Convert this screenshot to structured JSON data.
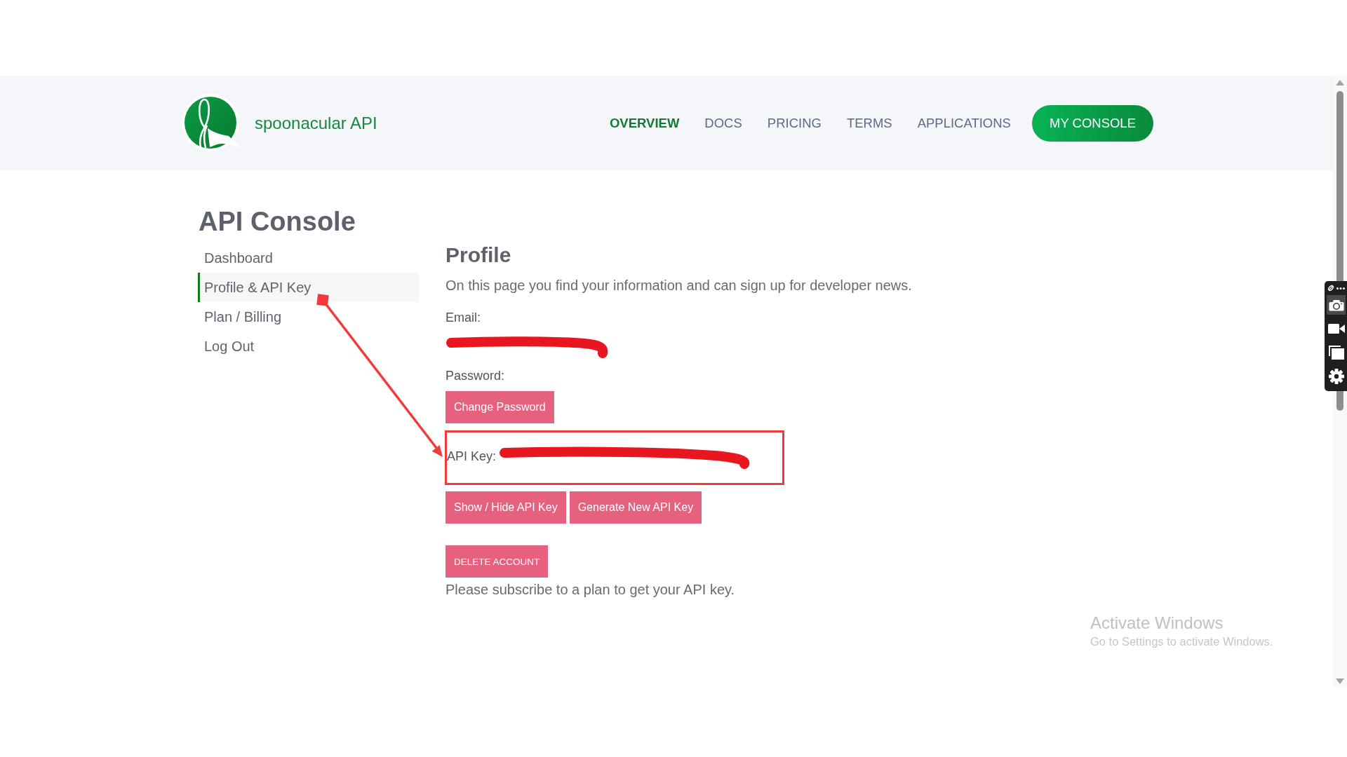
{
  "header": {
    "brand": "spoonacular API",
    "nav": [
      {
        "label": "OVERVIEW",
        "selected": true
      },
      {
        "label": "DOCS",
        "selected": false
      },
      {
        "label": "PRICING",
        "selected": false
      },
      {
        "label": "TERMS",
        "selected": false
      },
      {
        "label": "APPLICATIONS",
        "selected": false
      }
    ],
    "console_button": "MY CONSOLE"
  },
  "sidebar": {
    "title": "API Console",
    "items": [
      {
        "label": "Dashboard",
        "selected": false
      },
      {
        "label": "Profile & API Key",
        "selected": true
      },
      {
        "label": "Plan / Billing",
        "selected": false
      },
      {
        "label": "Log Out",
        "selected": false
      }
    ]
  },
  "profile": {
    "title": "Profile",
    "description": "On this page you find your information and can sign up for developer news.",
    "email": {
      "label": "Email:",
      "redacted": true
    },
    "password": {
      "label": "Password:",
      "button": "Change Password"
    },
    "api_key": {
      "label": "API Key:",
      "redacted": true,
      "highlighted": true
    },
    "key_buttons": [
      "Show / Hide API Key",
      "Generate New API Key"
    ],
    "delete_button": "DELETE ACCOUNT",
    "notice": "Please subscribe to a plan to get your API key."
  },
  "capture_toolbar": {
    "tools": [
      {
        "kind": "camera",
        "selected": true
      },
      {
        "kind": "video",
        "selected": false
      },
      {
        "kind": "windows",
        "selected": false
      },
      {
        "kind": "settings",
        "selected": false
      }
    ]
  },
  "os_notice": {
    "title": "Activate Windows",
    "text": "Go to Settings to activate Windows."
  }
}
